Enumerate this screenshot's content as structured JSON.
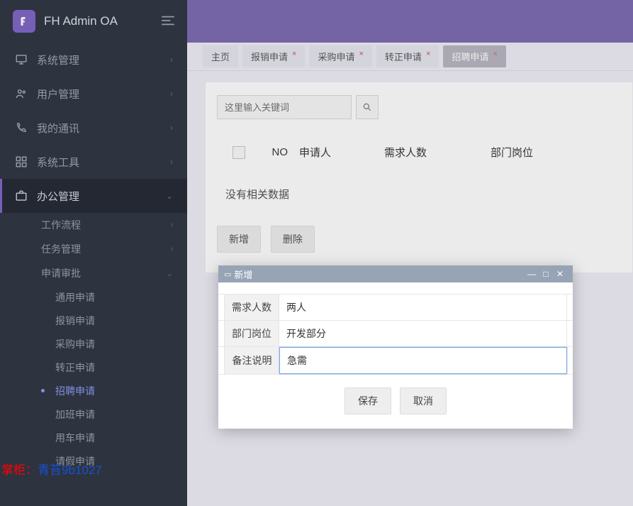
{
  "app": {
    "title": "FH Admin OA"
  },
  "sidebar": {
    "items": [
      {
        "label": "系统管理"
      },
      {
        "label": "用户管理"
      },
      {
        "label": "我的通讯"
      },
      {
        "label": "系统工具"
      },
      {
        "label": "办公管理"
      }
    ],
    "office_sub": [
      {
        "label": "工作流程"
      },
      {
        "label": "任务管理"
      },
      {
        "label": "申请审批"
      }
    ],
    "apply_sub": [
      {
        "label": "通用申请"
      },
      {
        "label": "报销申请"
      },
      {
        "label": "采购申请"
      },
      {
        "label": "转正申请"
      },
      {
        "label": "招聘申请"
      },
      {
        "label": "加班申请"
      },
      {
        "label": "用车申请"
      },
      {
        "label": "请假申请"
      }
    ]
  },
  "tabs": [
    {
      "label": "主页",
      "closable": false
    },
    {
      "label": "报销申请",
      "closable": true
    },
    {
      "label": "采购申请",
      "closable": true
    },
    {
      "label": "转正申请",
      "closable": true
    },
    {
      "label": "招聘申请",
      "closable": true,
      "active": true
    }
  ],
  "search": {
    "placeholder": "这里输入关键词"
  },
  "table": {
    "headers": {
      "no": "NO",
      "applicant": "申请人",
      "need": "需求人数",
      "position": "部门岗位"
    },
    "empty": "没有相关数据"
  },
  "actions": {
    "add": "新增",
    "delete": "删除"
  },
  "dialog": {
    "title": "新增",
    "fields": {
      "need_label": "需求人数",
      "need_value": "两人",
      "pos_label": "部门岗位",
      "pos_value": "开发部分",
      "remark_label": "备注说明",
      "remark_value": "急需"
    },
    "save": "保存",
    "cancel": "取消"
  },
  "watermark": {
    "prefix": "掌柜：",
    "code": "青苔9b1027"
  }
}
